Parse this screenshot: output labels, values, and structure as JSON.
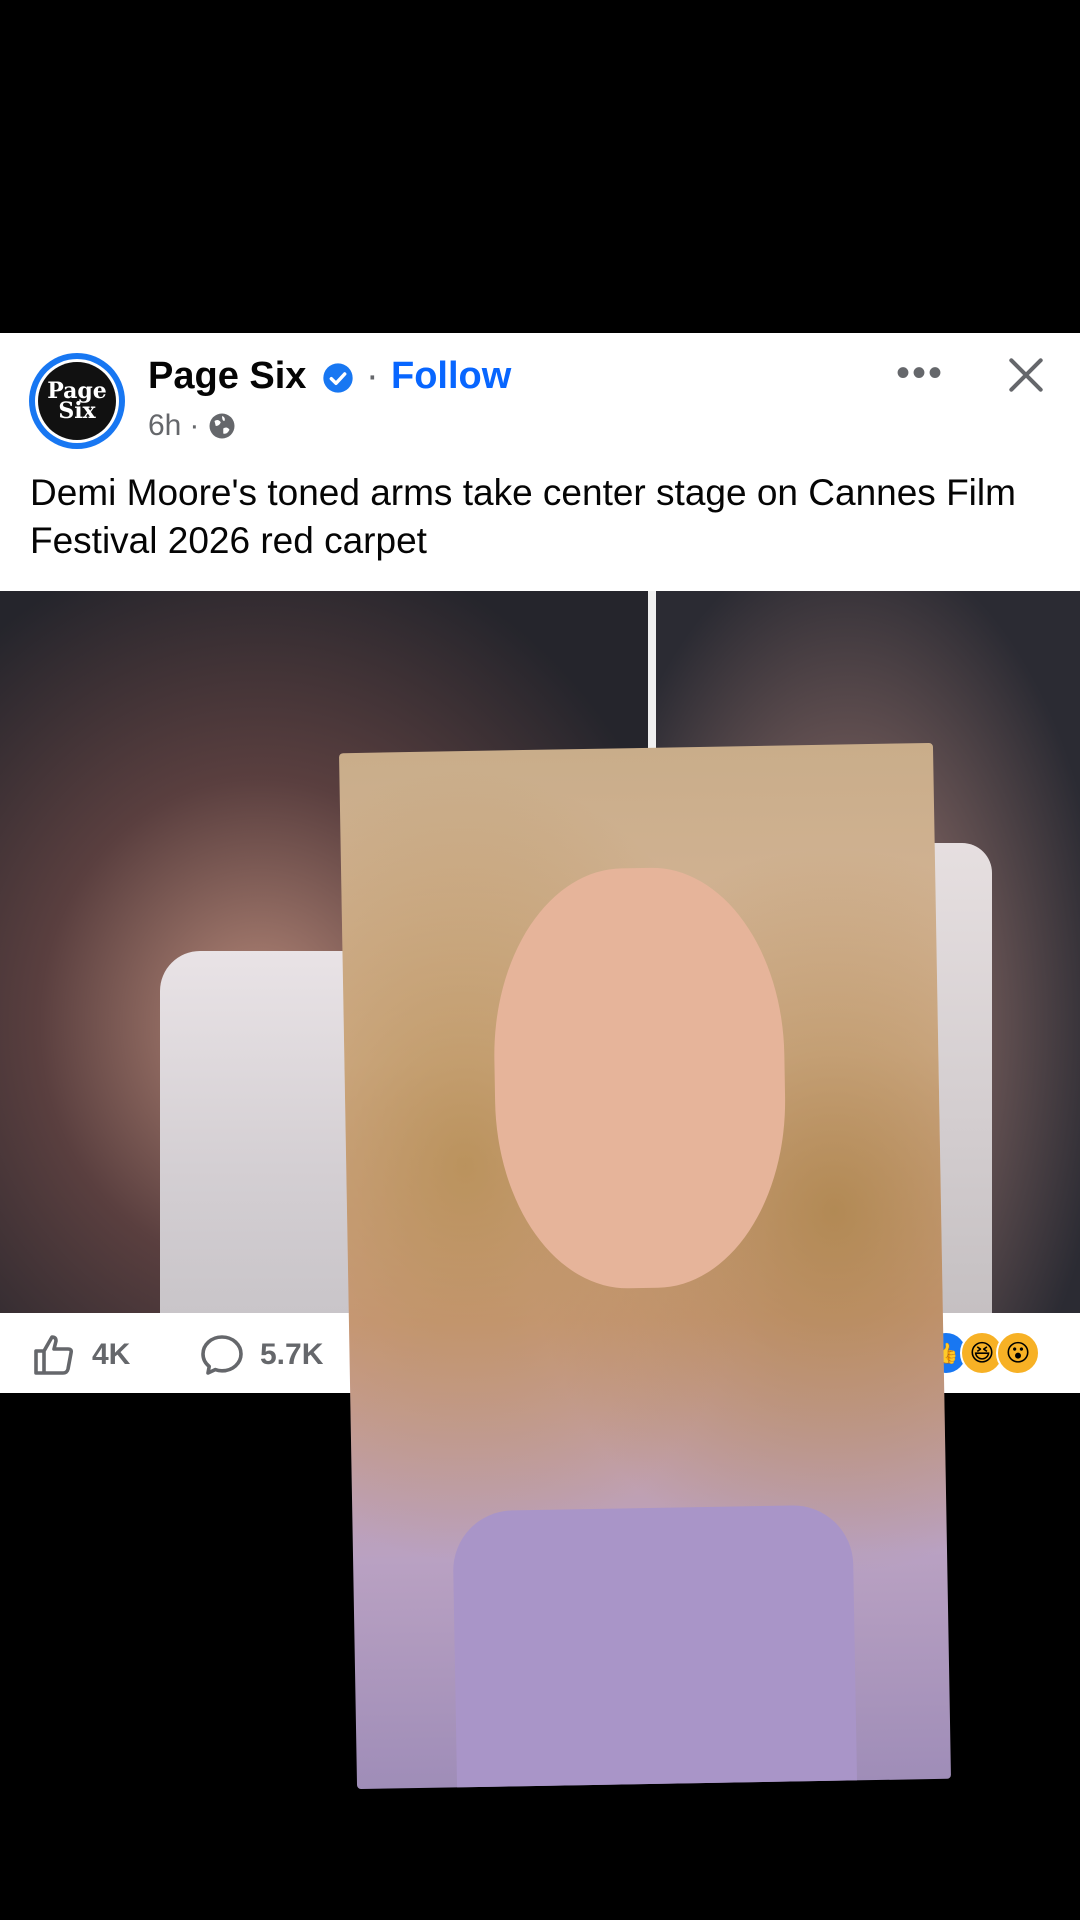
{
  "post": {
    "page_name": "Page Six",
    "avatar_text_line1": "Page",
    "avatar_text_line2": "Six",
    "follow_label": "Follow",
    "separator": "·",
    "time": "6h",
    "time_separator": "·",
    "more_label": "•••",
    "caption": "Demi Moore's toned arms take center stage on Cannes Film Festival 2026 red carpet",
    "actions": {
      "like_count": "4K",
      "comment_count": "5.7K"
    },
    "reactions": [
      "like-reaction",
      "haha-reaction",
      "wow-reaction"
    ],
    "reaction_glyphs": [
      "👍",
      "😆",
      "😮"
    ]
  },
  "colors": {
    "accent": "#0866ff",
    "verified": "#1877f2",
    "text_primary": "#050505",
    "text_secondary": "#65676b"
  }
}
